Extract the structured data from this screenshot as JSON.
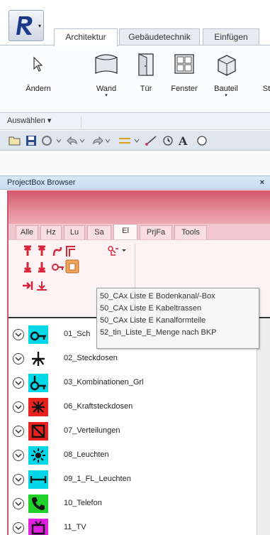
{
  "ribbon": {
    "tabs": [
      {
        "label": "Architektur",
        "active": true
      },
      {
        "label": "Gebäudetechnik",
        "active": false
      },
      {
        "label": "Einfügen",
        "active": false
      }
    ],
    "buttons": [
      {
        "label": "Ändern",
        "icon": "cursor-icon",
        "dropdown": false
      },
      {
        "label": "Wand",
        "icon": "wall-icon",
        "dropdown": true
      },
      {
        "label": "Tür",
        "icon": "door-icon",
        "dropdown": false
      },
      {
        "label": "Fenster",
        "icon": "window-icon",
        "dropdown": false
      },
      {
        "label": "Bauteil",
        "icon": "component-icon",
        "dropdown": true
      },
      {
        "label": "St",
        "icon": "",
        "dropdown": false
      }
    ],
    "group_label": "Auswählen ▾"
  },
  "quick_access": {
    "icons": [
      "open-icon",
      "save-icon",
      "sync-icon",
      "undo-icon",
      "redo-icon",
      "measure-icon",
      "dimension-icon",
      "tag-icon",
      "text-icon",
      "view-icon"
    ],
    "text_glyph": "A"
  },
  "browser": {
    "title": "ProjectBox Browser",
    "close_label": "×",
    "tabs": [
      {
        "label": "Alle",
        "active": false
      },
      {
        "label": "Hz",
        "active": false
      },
      {
        "label": "Lu",
        "active": false
      },
      {
        "label": "Sa",
        "active": false
      },
      {
        "label": "El",
        "active": true
      },
      {
        "label": "PrjFa",
        "active": false
      },
      {
        "label": "Tools",
        "active": false
      }
    ],
    "tooltip_items": [
      "50_CAx Liste E Bodenkanal/-Box",
      "50_CAx Liste E Kabeltrassen",
      "50_CAx Liste E Kanalformteile",
      "52_tin_Liste_E_Menge nach BKP"
    ],
    "list_items": [
      {
        "label": "01_Sch",
        "icon": "switch-symbol-icon",
        "bg": "#00d8e8"
      },
      {
        "label": "02_Steckdosen",
        "icon": "socket-symbol-icon",
        "bg": "#ffffff"
      },
      {
        "label": "03_Kombinationen_Grl",
        "icon": "combination-symbol-icon",
        "bg": "#00d8e8"
      },
      {
        "label": "06_Kraftsteckdosen",
        "icon": "power-socket-icon",
        "bg": "#e8201e"
      },
      {
        "label": "07_Verteilungen",
        "icon": "distribution-icon",
        "bg": "#e8201e"
      },
      {
        "label": "08_Leuchten",
        "icon": "light-icon",
        "bg": "#00d8e8"
      },
      {
        "label": "09_1_FL_Leuchten",
        "icon": "fluorescent-light-icon",
        "bg": "#00d8e8"
      },
      {
        "label": "10_Telefon",
        "icon": "phone-icon",
        "bg": "#1fd12a"
      },
      {
        "label": "11_TV",
        "icon": "tv-icon",
        "bg": "#e01fe0"
      }
    ]
  },
  "colors": {
    "accent_red": "#d6243a",
    "highlight_orange": "#f0a35a",
    "cyan": "#00d8e8"
  }
}
